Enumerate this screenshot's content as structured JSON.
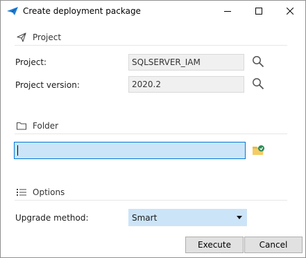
{
  "window": {
    "title": "Create deployment package",
    "controls": [
      "minimize-icon",
      "maximize-icon",
      "close-icon"
    ]
  },
  "project_section": {
    "title": "Project",
    "icon": "send-plane-icon",
    "project_label": "Project:",
    "project_value": "SQLSERVER_IAM",
    "version_label": "Project version:",
    "version_value": "2020.2"
  },
  "folder_section": {
    "title": "Folder",
    "icon": "folder-icon",
    "path_value": ""
  },
  "options_section": {
    "title": "Options",
    "icon": "list-icon",
    "upgrade_label": "Upgrade method:",
    "upgrade_value": "Smart"
  },
  "buttons": {
    "execute": "Execute",
    "cancel": "Cancel"
  },
  "colors": {
    "accent_border": "#0078d7",
    "input_highlight": "#cce4f7",
    "readonly_bg": "#f0f0f0",
    "button_bg": "#e1e1e1"
  }
}
